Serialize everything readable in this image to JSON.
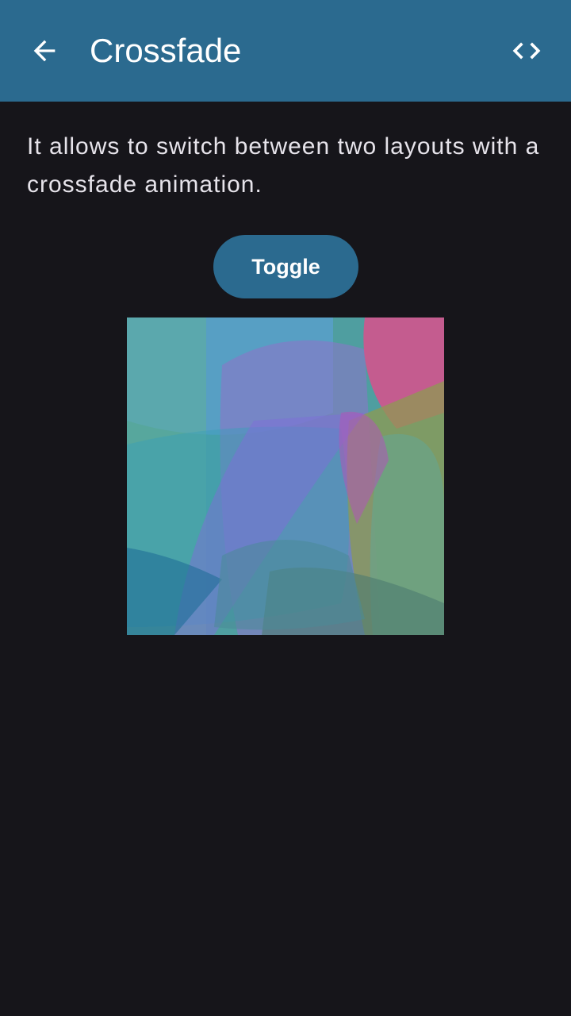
{
  "app_bar": {
    "title": "Crossfade",
    "back_icon": "arrow-back-icon",
    "code_icon": "code-icon"
  },
  "content": {
    "description": "It allows to switch between two layouts with a crossfade animation.",
    "toggle_label": "Toggle",
    "image": "abstract-overlapping-shapes"
  },
  "colors": {
    "app_bar": "#2b6a8f",
    "background": "#16151a",
    "button": "#2b6a8f",
    "text": "#e6e3ea"
  }
}
